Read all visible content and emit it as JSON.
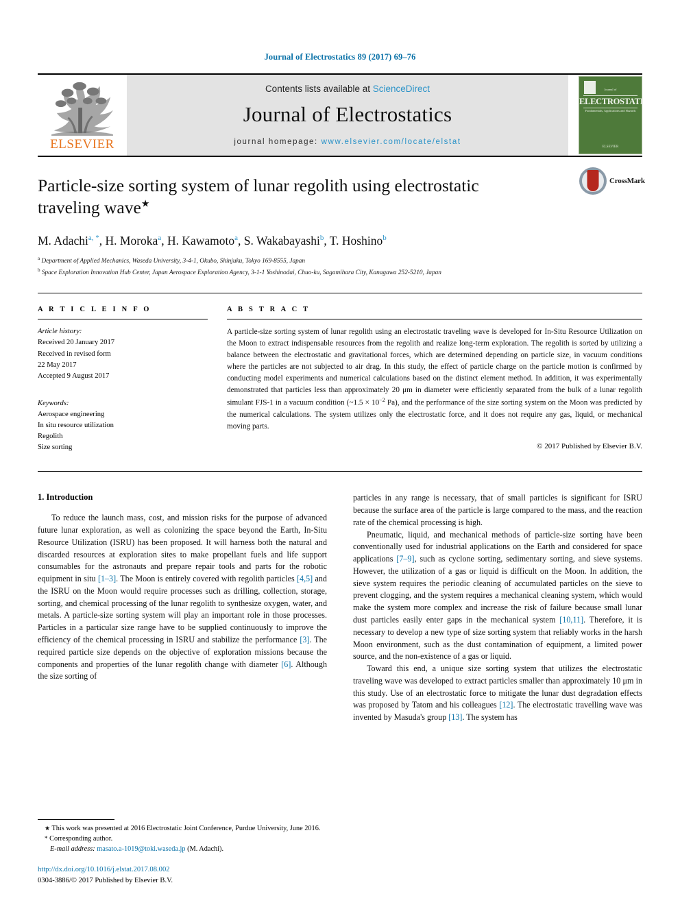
{
  "running_head": "Journal of Electrostatics 89 (2017) 69–76",
  "masthead": {
    "publisher_logo_text": "ELSEVIER",
    "contents_prefix": "Contents lists available at ",
    "contents_link": "ScienceDirect",
    "journal_name": "Journal of Electrostatics",
    "homepage_prefix": "journal homepage: ",
    "homepage_url": "www.elsevier.com/locate/elstat",
    "cover": {
      "small_top": "Journal of",
      "title": "ELECTROSTATICS",
      "subtitle": "Fundamentals, Applications and Hazards",
      "bottom": "ELSEVIER"
    }
  },
  "article": {
    "title": "Particle-size sorting system of lunar regolith using electrostatic traveling wave",
    "title_footnote_marker": "★",
    "crossmark_label": "CrossMark",
    "authors": [
      {
        "name": "M. Adachi",
        "marks": "a, *"
      },
      {
        "name": "H. Moroka",
        "marks": "a"
      },
      {
        "name": "H. Kawamoto",
        "marks": "a"
      },
      {
        "name": "S. Wakabayashi",
        "marks": "b"
      },
      {
        "name": "T. Hoshino",
        "marks": "b"
      }
    ],
    "affiliations": [
      {
        "mark": "a",
        "text": "Department of Applied Mechanics, Waseda University, 3-4-1, Okubo, Shinjuku, Tokyo 169-8555, Japan"
      },
      {
        "mark": "b",
        "text": "Space Exploration Innovation Hub Center, Japan Aerospace Exploration Agency, 3-1-1 Yoshinodai, Chuo-ku, Sagamihara City, Kanagawa 252-5210, Japan"
      }
    ]
  },
  "article_info": {
    "heading": "A R T I C L E   I N F O",
    "history_label": "Article history:",
    "history": [
      "Received 20 January 2017",
      "Received in revised form",
      "22 May 2017",
      "Accepted 9 August 2017"
    ],
    "keywords_label": "Keywords:",
    "keywords": [
      "Aerospace engineering",
      "In situ resource utilization",
      "Regolith",
      "Size sorting"
    ]
  },
  "abstract": {
    "heading": "A B S T R A C T",
    "part1": "A particle-size sorting system of lunar regolith using an electrostatic traveling wave is developed for In-Situ Resource Utilization on the Moon to extract indispensable resources from the regolith and realize long-term exploration. The regolith is sorted by utilizing a balance between the electrostatic and gravitational forces, which are determined depending on particle size, in vacuum conditions where the particles are not subjected to air drag. In this study, the effect of particle charge on the particle motion is confirmed by conducting model experiments and numerical calculations based on the distinct element method. In addition, it was experimentally demonstrated that particles less than approximately 20 μm in diameter were efficiently separated from the bulk of a lunar regolith simulant FJS-1 in a vacuum condition (~1.5 × 10",
    "exponent": "−2",
    "part2": " Pa), and the performance of the size sorting system on the Moon was predicted by the numerical calculations. The system utilizes only the electrostatic force, and it does not require any gas, liquid, or mechanical moving parts.",
    "copyright": "© 2017 Published by Elsevier B.V."
  },
  "introduction": {
    "heading": "1.  Introduction",
    "left_paragraphs": [
      {
        "p1": "To reduce the launch mass, cost, and mission risks for the purpose of advanced future lunar exploration, as well as colonizing the space beyond the Earth, In-Situ Resource Utilization (ISRU) has been proposed. It will harness both the natural and discarded resources at exploration sites to make propellant fuels and life support consumables for the astronauts and prepare repair tools and parts for the robotic equipment in situ ",
        "c1": "[1–3]",
        "p2": ". The Moon is entirely covered with regolith particles ",
        "c2": "[4,5]",
        "p3": " and the ISRU on the Moon would require processes such as drilling, collection, storage, sorting, and chemical processing of the lunar regolith to synthesize oxygen, water, and metals. A particle-size sorting system will play an important role in those processes. Particles in a particular size range have to be supplied continuously to improve the efficiency of the chemical processing in ISRU and stabilize the performance ",
        "c3": "[3]",
        "p4": ". The required particle size depends on the objective of exploration missions because the components and properties of the lunar regolith change with diameter ",
        "c4": "[6]",
        "p5": ". Although the size sorting of"
      }
    ],
    "right_paragraphs": [
      {
        "p1": "particles in any range is necessary, that of small particles is significant for ISRU because the surface area of the particle is large compared to the mass, and the reaction rate of the chemical processing is high."
      },
      {
        "p1": "Pneumatic, liquid, and mechanical methods of particle-size sorting have been conventionally used for industrial applications on the Earth and considered for space applications ",
        "c1": "[7–9]",
        "p2": ", such as cyclone sorting, sedimentary sorting, and sieve systems. However, the utilization of a gas or liquid is difficult on the Moon. In addition, the sieve system requires the periodic cleaning of accumulated particles on the sieve to prevent clogging, and the system requires a mechanical cleaning system, which would make the system more complex and increase the risk of failure because small lunar dust particles easily enter gaps in the mechanical system ",
        "c2": "[10,11]",
        "p3": ". Therefore, it is necessary to develop a new type of size sorting system that reliably works in the harsh Moon environment, such as the dust contamination of equipment, a limited power source, and the non-existence of a gas or liquid."
      },
      {
        "p1": "Toward this end, a unique size sorting system that utilizes the electrostatic traveling wave was developed to extract particles smaller than approximately 10 μm in this study. Use of an electrostatic force to mitigate the lunar dust degradation effects was proposed by Tatom and his colleagues ",
        "c1": "[12]",
        "p2": ". The electrostatic travelling wave was invented by Masuda's group ",
        "c2": "[13]",
        "p3": ". The system has"
      }
    ]
  },
  "footnotes": {
    "star_marker": "★",
    "star_text": " This work was presented at 2016 Electrostatic Joint Conference, Purdue University, June 2016.",
    "corr_marker": "*",
    "corr_text": " Corresponding author.",
    "email_label": "E-mail address: ",
    "email": "masato.a-1019@toki.waseda.jp",
    "email_suffix": " (M. Adachi).",
    "doi": "http://dx.doi.org/10.1016/j.elstat.2017.08.002",
    "issn_line": "0304-3886/© 2017 Published by Elsevier B.V."
  },
  "colors": {
    "link": "#0b72a8",
    "sciencedirect": "#2b93c8",
    "elsevier_orange": "#E87722",
    "cover_green": "#4e7a3a",
    "masthead_grey": "#e3e3e3"
  }
}
